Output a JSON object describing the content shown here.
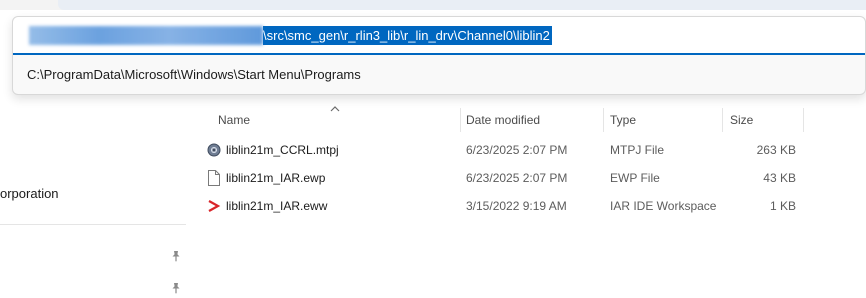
{
  "address_bar": {
    "path_tail": "\\src\\smc_gen\\r_rlin3_lib\\r_lin_drv\\Channel0\\liblin2"
  },
  "suggestion": {
    "path": "C:\\ProgramData\\Microsoft\\Windows\\Start Menu\\Programs"
  },
  "nav": {
    "items": [
      {
        "label": "orporation"
      }
    ]
  },
  "columns": {
    "name": "Name",
    "date_modified": "Date modified",
    "type": "Type",
    "size": "Size"
  },
  "files": [
    {
      "name": "liblin21m_CCRL.mtpj",
      "date": "6/23/2025 2:07 PM",
      "type": "MTPJ File",
      "size": "263 KB",
      "icon": "mtpj-file-icon"
    },
    {
      "name": "liblin21m_IAR.ewp",
      "date": "6/23/2025 2:07 PM",
      "type": "EWP File",
      "size": "43 KB",
      "icon": "blank-file-icon"
    },
    {
      "name": "liblin21m_IAR.eww",
      "date": "3/15/2022 9:19 AM",
      "type": "IAR IDE Workspace",
      "size": "1 KB",
      "icon": "iar-workspace-icon"
    }
  ],
  "colors": {
    "accent": "#0067c0",
    "iar_red": "#d9252a"
  }
}
